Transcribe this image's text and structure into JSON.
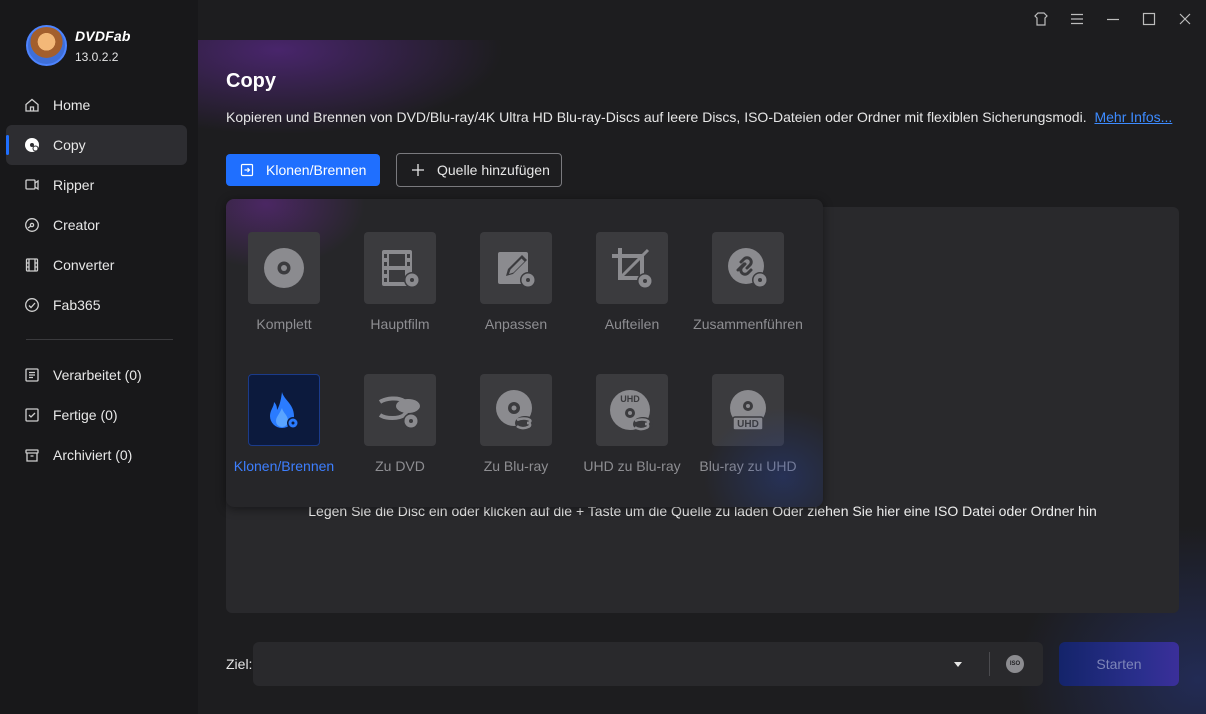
{
  "app": {
    "name": "DVDFab",
    "version": "13.0.2.2"
  },
  "sidebar": {
    "items": [
      {
        "label": "Home",
        "icon": "home-icon"
      },
      {
        "label": "Copy",
        "icon": "copy-disc-icon",
        "active": true
      },
      {
        "label": "Ripper",
        "icon": "ripper-icon"
      },
      {
        "label": "Creator",
        "icon": "creator-icon"
      },
      {
        "label": "Converter",
        "icon": "converter-icon"
      },
      {
        "label": "Fab365",
        "icon": "fab365-icon"
      }
    ],
    "queues": [
      {
        "label": "Verarbeitet (0)",
        "icon": "processing-list-icon"
      },
      {
        "label": "Fertige (0)",
        "icon": "finished-icon"
      },
      {
        "label": "Archiviert (0)",
        "icon": "archive-icon"
      }
    ]
  },
  "titlebar": {
    "icons": [
      "shirt-skin-icon",
      "menu-icon",
      "minimize-icon",
      "maximize-icon",
      "close-icon"
    ]
  },
  "page": {
    "title": "Copy",
    "description": "Kopieren und Brennen von DVD/Blu-ray/4K Ultra HD Blu-ray-Discs auf leere Discs, ISO-Dateien oder Ordner mit flexiblen Sicherungsmodi.",
    "more_link": "Mehr Infos..."
  },
  "toolbar": {
    "mode_button": "Klonen/Brennen",
    "add_source_button": "Quelle hinzufügen"
  },
  "modes": [
    {
      "label": "Komplett",
      "icon": "disc-full-icon"
    },
    {
      "label": "Hauptfilm",
      "icon": "film-strip-icon"
    },
    {
      "label": "Anpassen",
      "icon": "customize-edit-icon"
    },
    {
      "label": "Aufteilen",
      "icon": "split-crop-icon"
    },
    {
      "label": "Zusammenführen",
      "icon": "merge-link-icon"
    },
    {
      "label": "Klonen/Brennen",
      "icon": "clone-burn-flame-icon",
      "selected": true
    },
    {
      "label": "Zu DVD",
      "icon": "bluray-to-dvd-icon"
    },
    {
      "label": "Zu Blu-ray",
      "icon": "to-bluray-icon"
    },
    {
      "label": "UHD zu Blu-ray",
      "icon": "uhd-to-bluray-icon"
    },
    {
      "label": "Blu-ray zu UHD",
      "icon": "bluray-to-uhd-icon"
    }
  ],
  "drop_hint": "Legen Sie die Disc ein oder klicken auf die + Taste um die Quelle zu laden Oder ziehen Sie hier eine ISO Datei oder Ordner hin",
  "output": {
    "label": "Ziel:",
    "value": "",
    "iso_label": "ISO"
  },
  "start_button": "Starten",
  "colors": {
    "accent": "#1f6fff",
    "link": "#3d8bff",
    "sidebar_bg": "#18181a",
    "main_bg": "#1d1d1f"
  }
}
